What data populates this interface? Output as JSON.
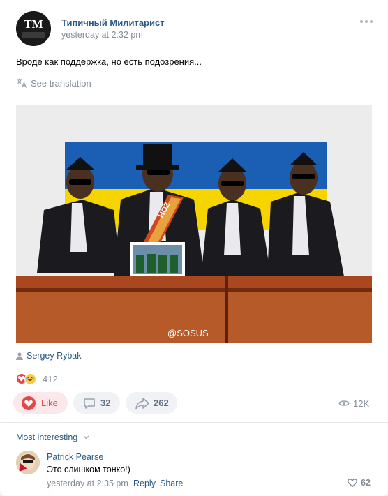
{
  "post": {
    "author": "Типичный Милитарист",
    "time": "yesterday at 2:32 pm",
    "text": "Вроде как поддержка, но есть подозрения...",
    "translate_label": "See translation",
    "avatar_text": "TM",
    "photo": {
      "watermark": "@SOSUS",
      "sash_text": "HOZ"
    },
    "photo_credit": "Sergey Rybak",
    "reactions_count": "412",
    "actions": {
      "like_label": "Like",
      "comments_count": "32",
      "shares_count": "262",
      "views_count": "12K"
    }
  },
  "comments": {
    "sort_label": "Most interesting",
    "items": [
      {
        "author": "Patrick Pearse",
        "text": "Это слишком тонко!)",
        "time": "yesterday at 2:35 pm",
        "reply_label": "Reply",
        "share_label": "Share",
        "likes": "62"
      }
    ]
  },
  "colors": {
    "link": "#2a5885",
    "like_red": "#e64646",
    "muted": "#818c99",
    "flag_blue": "#1a5fb4",
    "flag_yellow": "#f5d400"
  },
  "icons": [
    "more-icon",
    "translate-icon",
    "person-icon",
    "heart-reaction-icon",
    "laugh-reaction-icon",
    "heart-icon",
    "comment-icon",
    "share-icon",
    "eye-icon",
    "chevron-down-icon",
    "like-heart-icon"
  ]
}
